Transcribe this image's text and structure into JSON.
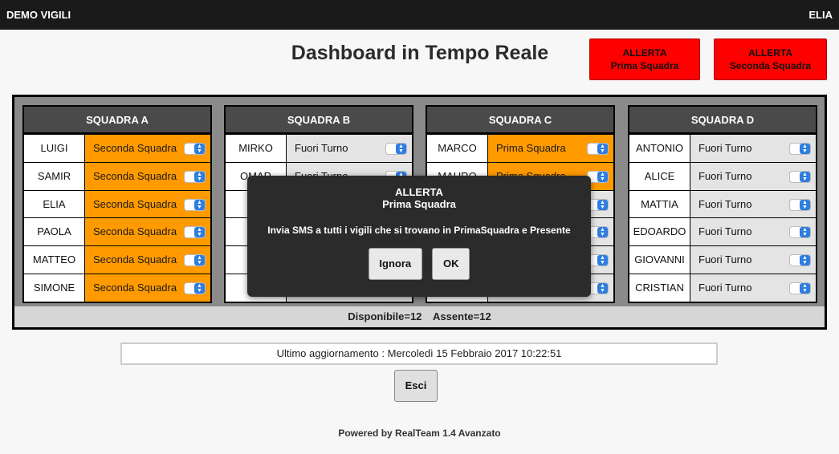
{
  "topbar": {
    "brand": "DEMO VIGILI",
    "user": "ELIA"
  },
  "title": "Dashboard in Tempo Reale",
  "alerts": [
    {
      "line1": "ALLERTA",
      "line2": "Prima Squadra"
    },
    {
      "line1": "ALLERTA",
      "line2": "Seconda Squadra"
    }
  ],
  "squads": [
    {
      "name": "SQUADRA A",
      "members": [
        {
          "name": "LUIGI",
          "status": "Seconda Squadra"
        },
        {
          "name": "SAMIR",
          "status": "Seconda Squadra"
        },
        {
          "name": "ELIA",
          "status": "Seconda Squadra"
        },
        {
          "name": "PAOLA",
          "status": "Seconda Squadra"
        },
        {
          "name": "MATTEO",
          "status": "Seconda Squadra"
        },
        {
          "name": "SIMONE",
          "status": "Seconda Squadra"
        }
      ]
    },
    {
      "name": "SQUADRA B",
      "members": [
        {
          "name": "MIRKO",
          "status": "Fuori Turno"
        },
        {
          "name": "OMAR",
          "status": "Fuori Turno"
        },
        {
          "name": "M",
          "status": ""
        },
        {
          "name": "",
          "status": ""
        },
        {
          "name": "",
          "status": ""
        },
        {
          "name": "G",
          "status": ""
        }
      ]
    },
    {
      "name": "SQUADRA C",
      "members": [
        {
          "name": "MARCO",
          "status": "Prima Squadra"
        },
        {
          "name": "MAURO",
          "status": "Prima Squadra"
        },
        {
          "name": "",
          "status": ""
        },
        {
          "name": "",
          "status": ""
        },
        {
          "name": "",
          "status": ""
        },
        {
          "name": "",
          "status": ""
        }
      ]
    },
    {
      "name": "SQUADRA D",
      "members": [
        {
          "name": "ANTONIO",
          "status": "Fuori Turno"
        },
        {
          "name": "ALICE",
          "status": "Fuori Turno"
        },
        {
          "name": "MATTIA",
          "status": "Fuori Turno"
        },
        {
          "name": "EDOARDO",
          "status": "Fuori Turno"
        },
        {
          "name": "GIOVANNI",
          "status": "Fuori Turno"
        },
        {
          "name": "CRISTIAN",
          "status": "Fuori Turno"
        }
      ]
    }
  ],
  "totals": {
    "available": "Disponibile=12",
    "absent": "Assente=12"
  },
  "modal": {
    "title1": "ALLERTA",
    "title2": "Prima Squadra",
    "message": "Invia SMS a tutti i vigili che si trovano in PrimaSquadra e Presente",
    "ignore_label": "Ignora",
    "ok_label": "OK"
  },
  "last_update": "Ultimo aggiornamento : Mercoledì 15 Febbraio 2017 10:22:51",
  "exit_label": "Esci",
  "footer": "Powered by RealTeam 1.4 Avanzato",
  "colors": {
    "alert": "#ff0000",
    "orange_status": "#ff9a00",
    "grey_status": "#e4e4e4",
    "header": "#4a4a4a",
    "topbar": "#1a1a1a"
  }
}
